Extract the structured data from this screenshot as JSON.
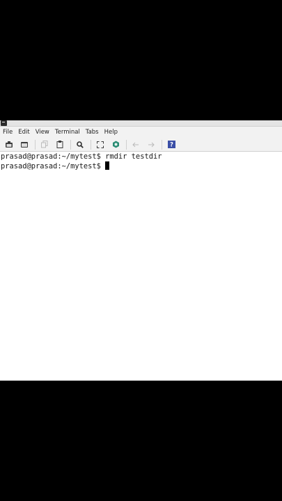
{
  "menu": {
    "items": [
      "File",
      "Edit",
      "View",
      "Terminal",
      "Tabs",
      "Help"
    ]
  },
  "toolbar": {
    "buttons": [
      {
        "icon": "new-window-icon"
      },
      {
        "icon": "new-tab-icon"
      },
      {
        "icon": "copy-icon"
      },
      {
        "icon": "paste-icon"
      },
      {
        "icon": "search-icon"
      },
      {
        "icon": "fullscreen-icon"
      },
      {
        "icon": "preferences-icon"
      },
      {
        "icon": "back-arrow-icon"
      },
      {
        "icon": "forward-arrow-icon"
      },
      {
        "icon": "help-icon",
        "label": "?"
      }
    ]
  },
  "terminal": {
    "lines": [
      {
        "prompt": "prasad@prasad:~/mytest$",
        "command": " rmdir testdir"
      },
      {
        "prompt": "prasad@prasad:~/mytest$",
        "command": ""
      }
    ]
  },
  "colors": {
    "help_blue": "#3a4ea6",
    "preferences_green": "#2a8c74",
    "menubar_bg": "#f2f2f2",
    "terminal_bg": "#ffffff",
    "terminal_fg": "#1a1a1a"
  }
}
